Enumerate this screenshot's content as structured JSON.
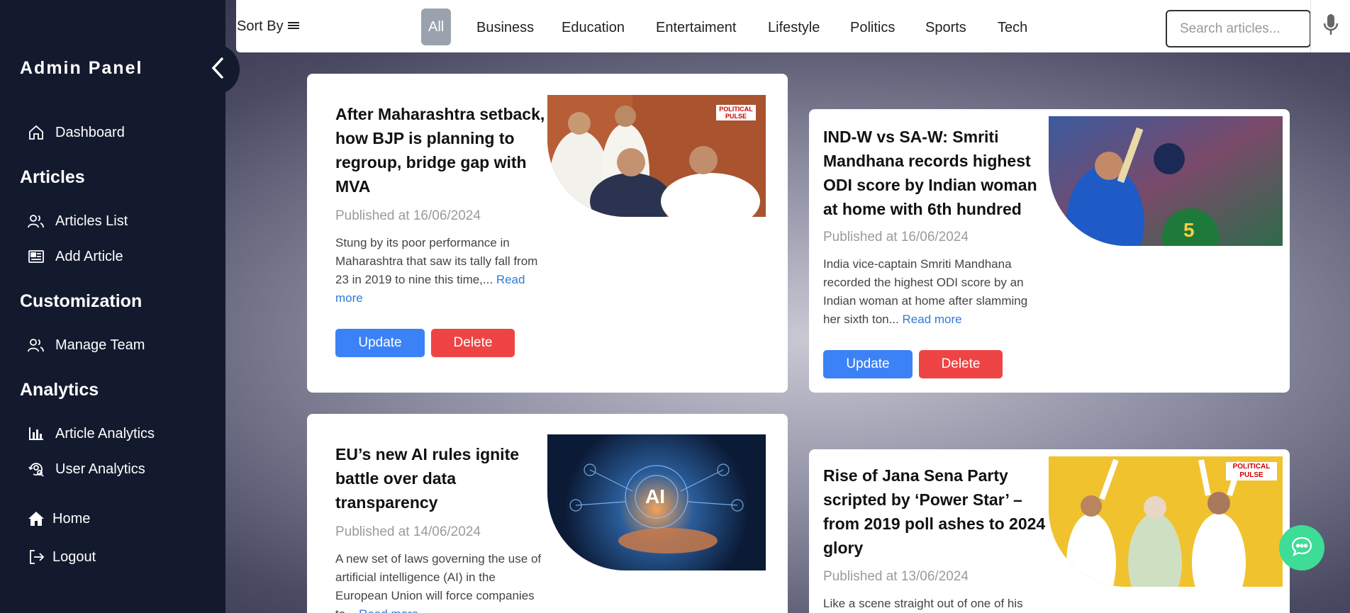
{
  "sidebar": {
    "brand": "Admin Panel",
    "dashboard": "Dashboard",
    "section_articles": "Articles",
    "articles_list": "Articles List",
    "add_article": "Add Article",
    "section_customization": "Customization",
    "manage_team": "Manage Team",
    "section_analytics": "Analytics",
    "article_analytics": "Article Analytics",
    "user_analytics": "User Analytics",
    "home": "Home",
    "logout": "Logout"
  },
  "topbar": {
    "sort_by": "Sort By",
    "categories": [
      "All",
      "Business",
      "Education",
      "Entertaiment",
      "Lifestyle",
      "Politics",
      "Sports",
      "Tech"
    ],
    "active_category": "All",
    "search_placeholder": "Search articles..."
  },
  "articles": [
    {
      "title": "After Maharashtra setback, how BJP is planning to regroup, bridge gap with MVA",
      "date": "Published at 16/06/2024",
      "excerpt": "Stung by its poor performance in Maharashtra that saw its tally fall from 23 in 2019 to nine this time,...",
      "read_more": "Read more",
      "update": "Update",
      "delete": "Delete",
      "badge": "POLITICAL PULSE"
    },
    {
      "title": "IND-W vs SA-W: Smriti Mandhana records highest ODI score by Indian woman at home with 6th hundred",
      "date": "Published at 16/06/2024",
      "excerpt": "India vice-captain Smriti Mandhana recorded the highest ODI score by an Indian woman at home after slamming her sixth ton...",
      "read_more": "Read more",
      "update": "Update",
      "delete": "Delete"
    },
    {
      "title": "EU’s new AI rules ignite battle over data transparency",
      "date": "Published at 14/06/2024",
      "excerpt": "A new set of laws governing the use of artificial intelligence (AI) in the European Union will force companies to...",
      "read_more": "Read more",
      "image_text": "AI"
    },
    {
      "title": "Rise of Jana Sena Party scripted by ‘Power Star’ – from 2019 poll ashes to 2024 glory",
      "date": "Published at 13/06/2024",
      "excerpt": "Like a scene straight out of one of his",
      "badge": "POLITICAL PULSE"
    }
  ],
  "colors": {
    "sidebar_bg": "#141a2e",
    "update_btn": "#3b82f6",
    "delete_btn": "#ef4444",
    "link": "#2f7ad8",
    "active_tab": "#9aa3ad",
    "chat_fab": "#3ddc97"
  }
}
